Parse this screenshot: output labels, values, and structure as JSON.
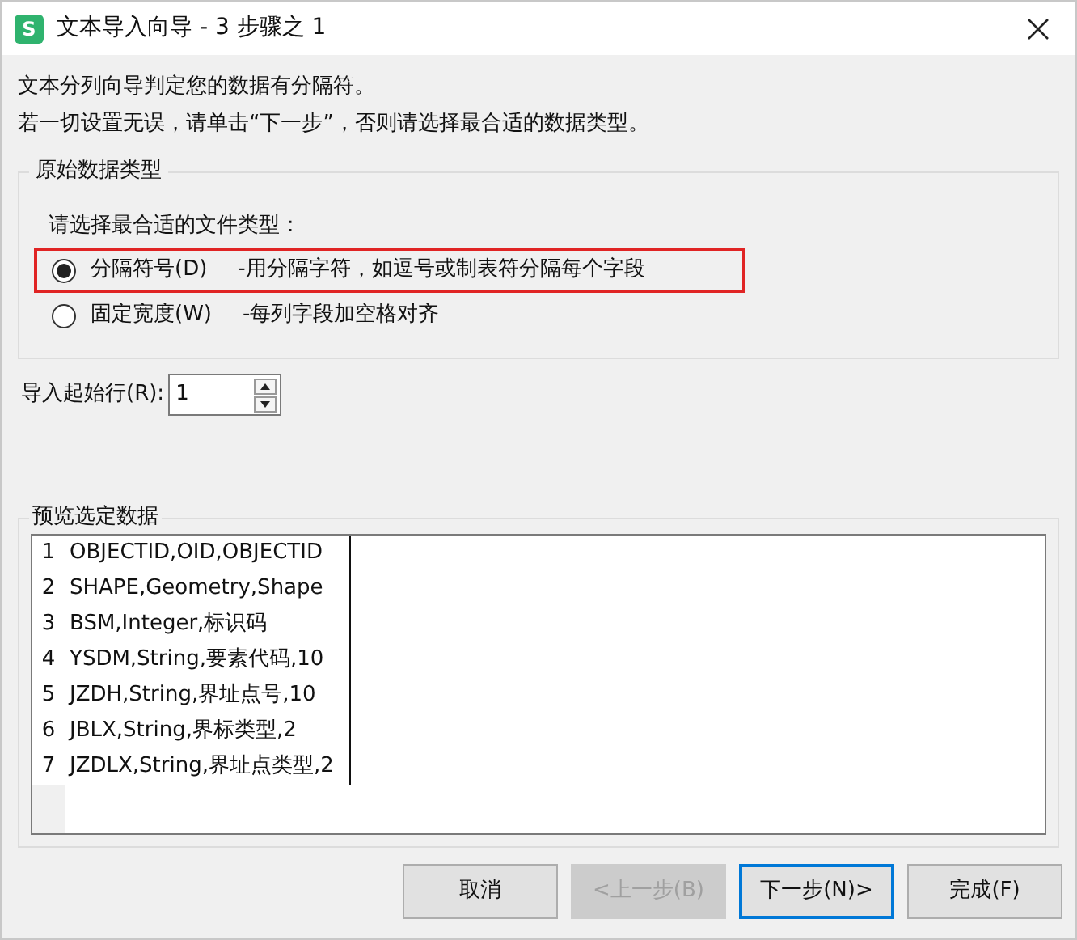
{
  "window": {
    "title": "文本导入向导 - 3 步骤之 1",
    "app_icon": "S"
  },
  "intro": [
    "文本分列向导判定您的数据有分隔符。",
    "若一切设置无误，请单击“下一步”，否则请选择最合适的数据类型。"
  ],
  "original_type": {
    "legend": "原始数据类型",
    "prompt": "请选择最合适的文件类型：",
    "options": [
      {
        "label": "分隔符号(D)",
        "description": "-用分隔字符，如逗号或制表符分隔每个字段",
        "selected": true,
        "highlighted": true
      },
      {
        "label": "固定宽度(W)",
        "description": "-每列字段加空格对齐",
        "selected": false,
        "highlighted": false
      }
    ]
  },
  "start_row": {
    "label": "导入起始行(R):",
    "value": "1"
  },
  "preview": {
    "legend": "预览选定数据",
    "rows": [
      {
        "number": "1",
        "text": "OBJECTID,OID,OBJECTID"
      },
      {
        "number": "2",
        "text": "SHAPE,Geometry,Shape"
      },
      {
        "number": "3",
        "text": "BSM,Integer,标识码"
      },
      {
        "number": "4",
        "text": "YSDM,String,要素代码,10"
      },
      {
        "number": "5",
        "text": "JZDH,String,界址点号,10"
      },
      {
        "number": "6",
        "text": "JBLX,String,界标类型,2"
      },
      {
        "number": "7",
        "text": "JZDLX,String,界址点类型,2"
      }
    ]
  },
  "buttons": [
    {
      "label": "取消",
      "disabled": false,
      "default": false
    },
    {
      "label": "<上一步(B)",
      "disabled": true,
      "default": false
    },
    {
      "label": "下一步(N)>",
      "disabled": false,
      "default": true
    },
    {
      "label": "完成(F)",
      "disabled": false,
      "default": false
    }
  ]
}
